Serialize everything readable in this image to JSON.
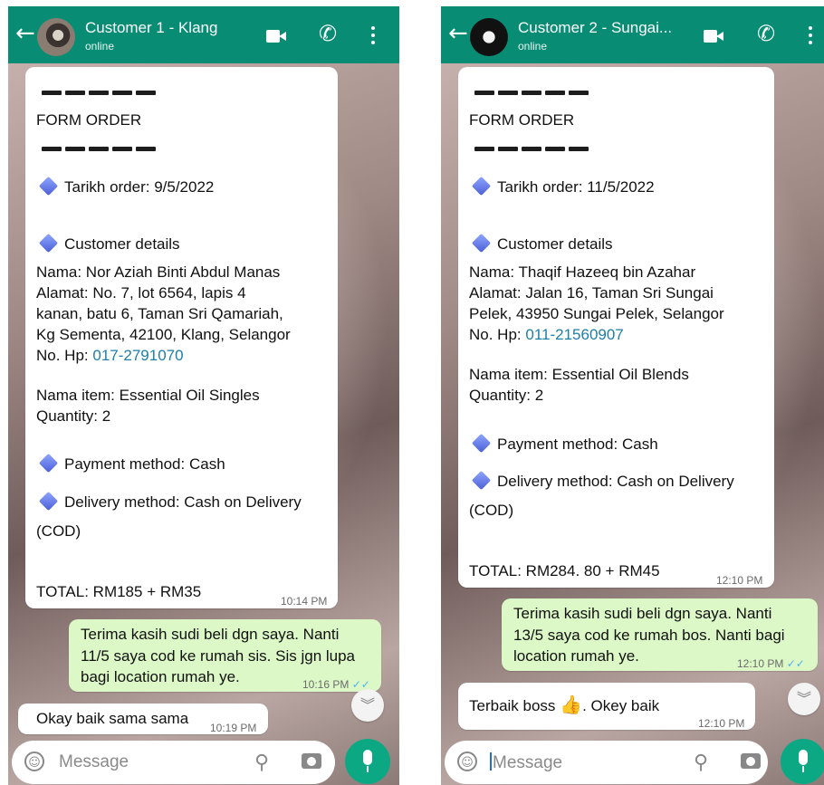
{
  "left": {
    "header": {
      "back_icon": "←",
      "name": "Customer 1 - Klang",
      "status": "online"
    },
    "form": {
      "dash_row": "— — — — —",
      "title": "FORM ORDER",
      "date_line": "Tarikh order: 9/5/2022",
      "customer_heading": "Customer details",
      "nama": "Nama: Nor Aziah Binti Abdul Manas",
      "alamat_1": "Alamat: No. 7, lot 6564, lapis 4",
      "alamat_2": "kanan, batu 6, Taman Sri Qamariah,",
      "alamat_3": "Kg Sementa, 42100, Klang, Selangor",
      "hp_label": "No. Hp: ",
      "hp_number": "017-2791070",
      "item": "Nama item: Essential Oil Singles",
      "qty": "Quantity: 2",
      "payment": "Payment method: Cash",
      "delivery_1": "Delivery method: Cash on Delivery",
      "delivery_2": "(COD)",
      "total": "TOTAL: RM185 + RM35",
      "time": "10:14 PM"
    },
    "reply": {
      "line1": "Terima kasih sudi beli dgn saya. Nanti",
      "line2": "11/5 saya cod ke rumah sis. Sis jgn lupa",
      "line3": "bagi location rumah ye.",
      "time": "10:16 PM",
      "ticks": "✓✓"
    },
    "incoming": {
      "text": "Okay baik sama sama",
      "time": "10:19 PM"
    },
    "input": {
      "placeholder": "Message"
    }
  },
  "right": {
    "header": {
      "back_icon": "←",
      "name": "Customer 2 - Sungai...",
      "status": "online"
    },
    "form": {
      "dash_row": "— — — — —",
      "title": "FORM ORDER",
      "date_line": "Tarikh order: 11/5/2022",
      "customer_heading": "Customer details",
      "nama": "Nama: Thaqif Hazeeq bin Azahar",
      "alamat_1": "Alamat: Jalan 16, Taman Sri Sungai",
      "alamat_2": "Pelek, 43950 Sungai Pelek, Selangor",
      "hp_label": "No. Hp: ",
      "hp_number": "011-21560907",
      "item": "Nama item: Essential Oil Blends",
      "qty": "Quantity: 2",
      "payment": "Payment method: Cash",
      "delivery_1": "Delivery method: Cash on Delivery",
      "delivery_2": "(COD)",
      "total": "TOTAL: RM284. 80 + RM45",
      "time": "12:10 PM"
    },
    "reply": {
      "line1": "Terima kasih sudi beli dgn saya. Nanti",
      "line2": "13/5 saya cod ke rumah bos. Nanti bagi",
      "line3": "location rumah ye.",
      "time": "12:10 PM",
      "ticks": "✓✓"
    },
    "incoming": {
      "text_a": "Terbaik boss ",
      "emoji": "👍",
      "text_b": ". Okey baik",
      "time": "12:10 PM"
    },
    "input": {
      "placeholder": "Message"
    }
  },
  "colors": {
    "header": "#088c74",
    "outgoing_bubble": "#dcf8c6",
    "mic_button": "#0ca884",
    "link": "#1d7ea8",
    "read_ticks": "#4fb6ec"
  },
  "icons": [
    "back-arrow-icon",
    "avatar",
    "video-call-icon",
    "phone-call-icon",
    "more-options-icon",
    "diamond-bullet-icon",
    "double-chevron-down-icon",
    "emoji-icon",
    "attach-clip-icon",
    "camera-icon",
    "mic-icon"
  ]
}
